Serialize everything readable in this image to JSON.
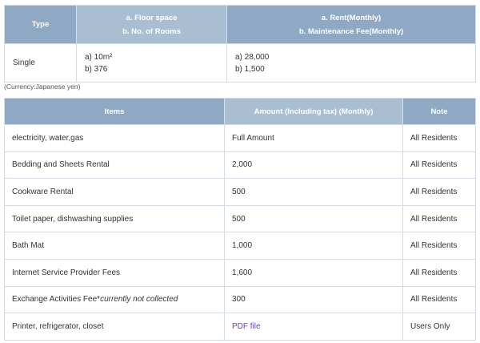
{
  "room_table": {
    "headers": {
      "type": "Type",
      "floor_line1": "a. Floor space",
      "floor_line2": "b. No. of Rooms",
      "rent_line1": "a. Rent(Monthly)",
      "rent_line2": "b. Maintenance Fee(Monthly)"
    },
    "row": {
      "type": "Single",
      "floor_a": "a) 10m²",
      "floor_b": "b) 376",
      "rent_a": "a) 28,000",
      "rent_b": "b) 1,500"
    }
  },
  "currency_note": "(Currency:Japanese yen)",
  "fee_table": {
    "headers": {
      "items": "Items",
      "amount": "Amount (Including tax) (Monthly)",
      "note": "Note"
    },
    "rows": [
      {
        "item": "electricity, water,gas",
        "amount": "Full Amount",
        "note": "All Residents"
      },
      {
        "item": "Bedding and Sheets Rental",
        "amount": "2,000",
        "note": "All Residents"
      },
      {
        "item": "Cookware Rental",
        "amount": "500",
        "note": "All Residents"
      },
      {
        "item": "Toilet paper, dishwashing supplies",
        "amount": "500",
        "note": "All Residents"
      },
      {
        "item": "Bath Mat",
        "amount": "1,000",
        "note": "All Residents"
      },
      {
        "item": "Internet Service Provider Fees",
        "amount": "1,600",
        "note": "All Residents"
      },
      {
        "item": "Exchange Activities Fee*",
        "item_note": "currently not collected",
        "amount": "300",
        "note": "All Residents"
      },
      {
        "item": "Printer, refrigerator, closet",
        "amount": "PDF file",
        "note": "Users Only"
      }
    ]
  },
  "colors": {
    "header_dark": "#8fa9c4",
    "header_light": "#a9bfd1",
    "link": "#6a3fb0"
  }
}
